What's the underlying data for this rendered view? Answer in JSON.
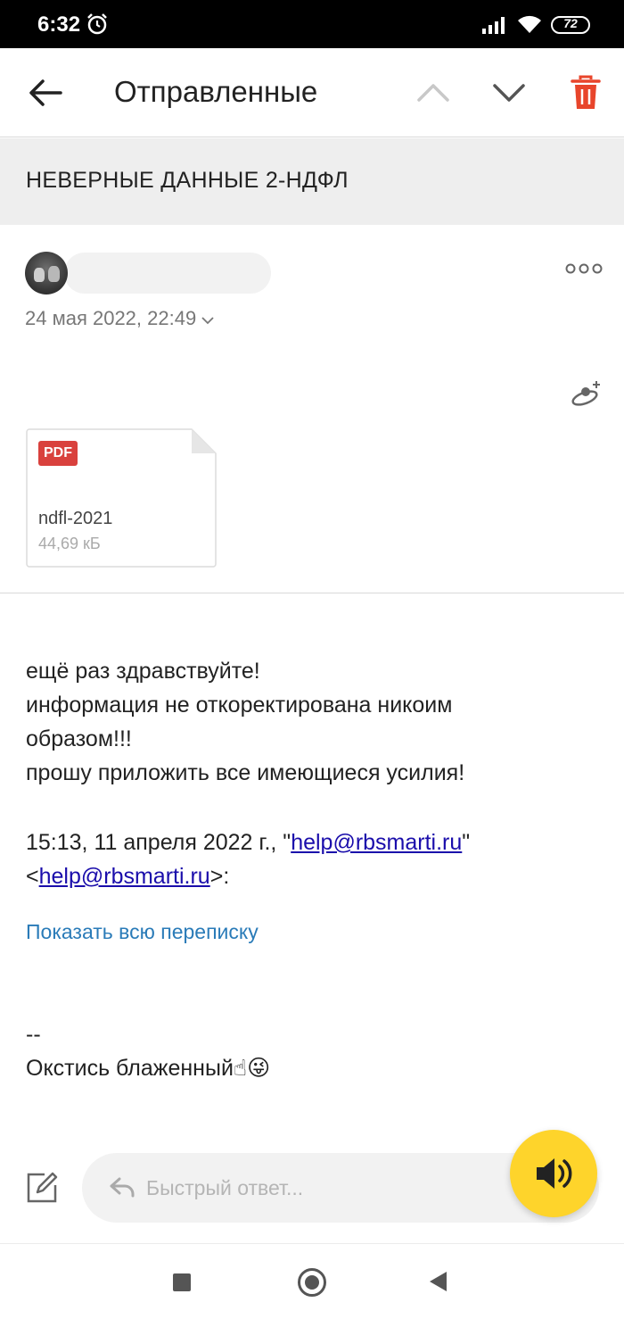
{
  "status_bar": {
    "time": "6:32",
    "battery": "72"
  },
  "toolbar": {
    "title": "Отправленные"
  },
  "subject": "НЕВЕРНЫЕ ДАННЫЕ 2-НДФЛ",
  "message": {
    "date": "24 мая 2022, 22:49",
    "attachment": {
      "type_badge": "PDF",
      "name": "ndfl-2021",
      "size": "44,69 кБ"
    },
    "body_lines": [
      "ещё раз здравствуйте!",
      "информация не откоректирована никоим",
      "образом!!!",
      "прошу приложить все имеющиеся усилия!"
    ],
    "quote": {
      "prefix": "15:13, 11 апреля 2022 г., \"",
      "email": "help@rbsmarti.ru",
      "mid": "\"",
      "open": "<",
      "close": ">:"
    },
    "show_all": "Показать всю переписку",
    "signature_sep": "--",
    "signature": "Окстись блаженный☝😜"
  },
  "reply": {
    "placeholder": "Быстрый ответ..."
  },
  "colors": {
    "accent_yellow": "#fed42b",
    "trash_red": "#e8452b",
    "link_blue": "#1a0dab",
    "show_all_blue": "#2a7bb8"
  }
}
